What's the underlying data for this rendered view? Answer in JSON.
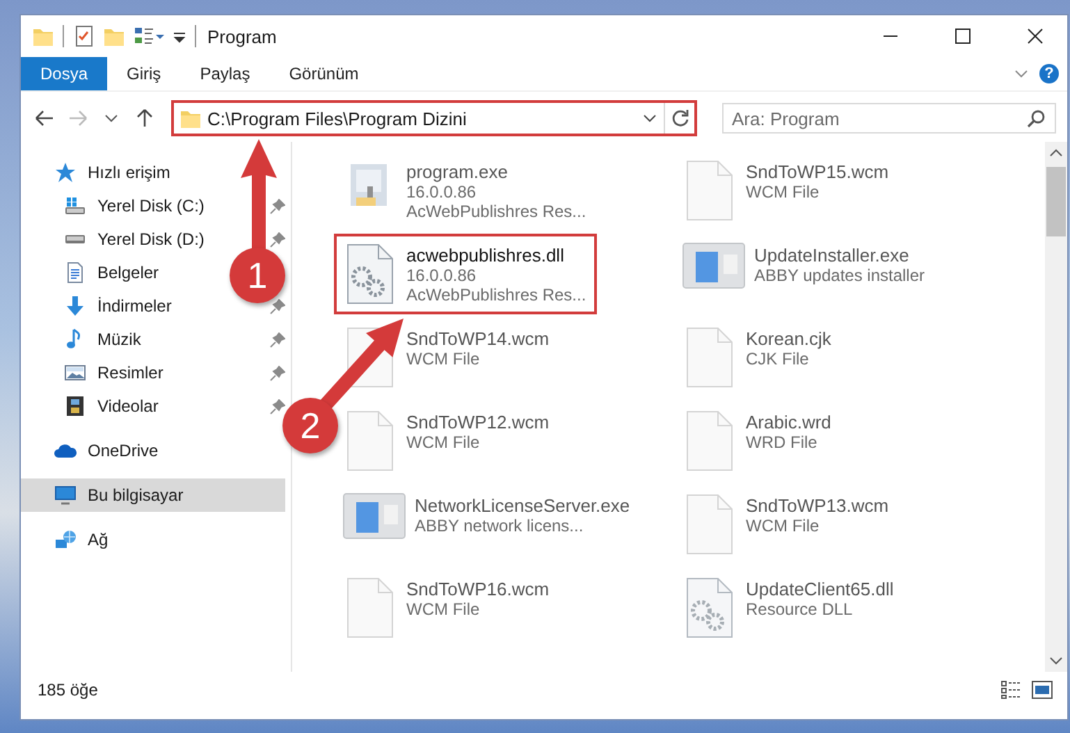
{
  "window": {
    "title": "Program"
  },
  "ribbon": {
    "tabs": [
      {
        "label": "Dosya",
        "selected": true
      },
      {
        "label": "Giriş",
        "selected": false
      },
      {
        "label": "Paylaş",
        "selected": false
      },
      {
        "label": "Görünüm",
        "selected": false
      }
    ],
    "help": "?"
  },
  "address": {
    "path": "C:\\Program Files\\Program Dizini",
    "highlighted": true
  },
  "search": {
    "placeholder": "Ara: Program"
  },
  "sidebar": {
    "items": [
      {
        "label": "Hızlı erişim",
        "kind": "star",
        "selected": false,
        "children": [
          {
            "label": "Yerel Disk (C:)",
            "kind": "windrive",
            "pinned": true,
            "selected": false
          },
          {
            "label": "Yerel Disk (D:)",
            "kind": "drive",
            "pinned": true,
            "selected": false
          },
          {
            "label": "Belgeler",
            "kind": "document",
            "pinned": false,
            "selected": false
          },
          {
            "label": "İndirmeler",
            "kind": "download",
            "pinned": true,
            "selected": false
          },
          {
            "label": "Müzik",
            "kind": "music",
            "pinned": true,
            "selected": false
          },
          {
            "label": "Resimler",
            "kind": "pictures",
            "pinned": true,
            "selected": false
          },
          {
            "label": "Videolar",
            "kind": "video",
            "pinned": true,
            "selected": false
          }
        ]
      },
      {
        "label": "OneDrive",
        "kind": "cloud",
        "selected": false
      },
      {
        "label": "Bu bilgisayar",
        "kind": "computer",
        "selected": true
      },
      {
        "label": "Ağ",
        "kind": "network",
        "selected": false
      }
    ]
  },
  "files": [
    {
      "name": "program.exe",
      "lines": [
        "16.0.0.86",
        "AcWebPublishres Res..."
      ],
      "kind": "app",
      "highlighted": false
    },
    {
      "name": "SndToWP15.wcm",
      "lines": [
        "WCM File"
      ],
      "kind": "blank",
      "highlighted": false
    },
    {
      "name": "acwebpublishres.dll",
      "lines": [
        "16.0.0.86",
        "AcWebPublishres Res..."
      ],
      "kind": "dll",
      "highlighted": true
    },
    {
      "name": "UpdateInstaller.exe",
      "lines": [
        "ABBY updates installer"
      ],
      "kind": "window",
      "highlighted": false
    },
    {
      "name": "SndToWP14.wcm",
      "lines": [
        "WCM File"
      ],
      "kind": "blank",
      "highlighted": false
    },
    {
      "name": "Korean.cjk",
      "lines": [
        "CJK File"
      ],
      "kind": "blank",
      "highlighted": false
    },
    {
      "name": "SndToWP12.wcm",
      "lines": [
        "WCM File"
      ],
      "kind": "blank",
      "highlighted": false
    },
    {
      "name": "Arabic.wrd",
      "lines": [
        "WRD File"
      ],
      "kind": "blank",
      "highlighted": false
    },
    {
      "name": "NetworkLicenseServer.exe",
      "lines": [
        "ABBY network licens..."
      ],
      "kind": "window",
      "highlighted": false
    },
    {
      "name": "SndToWP13.wcm",
      "lines": [
        "WCM File"
      ],
      "kind": "blank",
      "highlighted": false
    },
    {
      "name": "SndToWP16.wcm",
      "lines": [
        "WCM File"
      ],
      "kind": "blank",
      "highlighted": false
    },
    {
      "name": "UpdateClient65.dll",
      "lines": [
        "Resource DLL"
      ],
      "kind": "dll",
      "highlighted": false
    }
  ],
  "status_bar": {
    "count": "185 öğe"
  },
  "annotations": [
    {
      "label": "1"
    },
    {
      "label": "2"
    }
  ]
}
